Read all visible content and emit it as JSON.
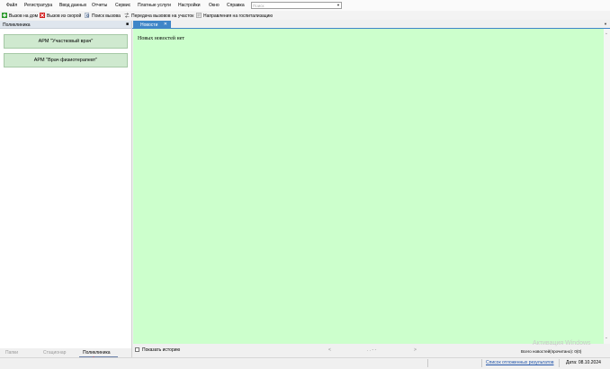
{
  "menu": [
    "Файл",
    "Регистратура",
    "Ввод данных",
    "Отчеты",
    "Сервис",
    "Платные услуги",
    "Настройки",
    "Окно",
    "Справка"
  ],
  "search": {
    "placeholder": "Поиск"
  },
  "toolbar": [
    {
      "label": "Вызов на дом",
      "icon": "green-plus-icon"
    },
    {
      "label": "Вызов из скорой",
      "icon": "red-cross-icon"
    },
    {
      "label": "Поиск вызова",
      "icon": "search-doc-icon"
    },
    {
      "label": "Передача вызовов на участок",
      "icon": "transfer-icon"
    },
    {
      "label": "Направления на госпитализацию",
      "icon": "referral-icon"
    }
  ],
  "left_panel": {
    "title": "Поликлиника",
    "arms": [
      "АРМ \"Участковый врач\"",
      "АРМ \"Врач физиотерапевт\""
    ],
    "tabs": [
      "Папки",
      "Стационар",
      "Поликлиника"
    ],
    "active_tab": 2
  },
  "news": {
    "tab_label": "Новости",
    "empty_text": "Новых новостей нет",
    "history_label": "Показать историю",
    "prev": "<",
    "page": ". . - -",
    "next": ">",
    "total": "Всего новостей(прочитано): 0(0)"
  },
  "watermark": "Активация Windows",
  "status": {
    "deferred_link": "Список отложенных результатов",
    "date": "Дата: 08.10.2024"
  },
  "colors": {
    "content_bg": "#ccffcc",
    "tab_active": "#3f86c8",
    "arm_bg": "#cfe9cf",
    "annotation": "#e03030"
  }
}
